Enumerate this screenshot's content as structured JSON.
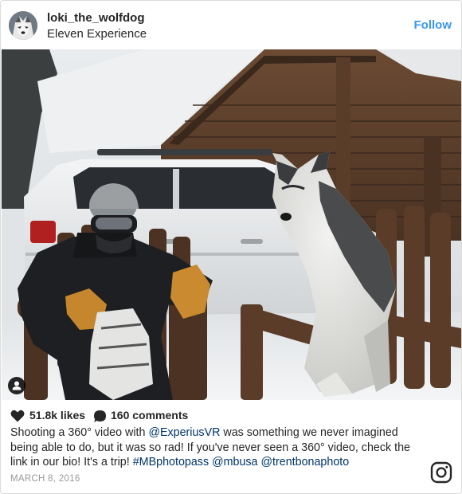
{
  "post": {
    "username": "loki_the_wolfdog",
    "location": "Eleven Experience",
    "follow_label": "Follow",
    "likes": "51.8k likes",
    "comments": "160 comments",
    "caption_parts": [
      {
        "text": "Shooting a 360° video with ",
        "mention": false
      },
      {
        "text": "@ExperiusVR",
        "mention": true
      },
      {
        "text": " was something we never imagined being able to do, but it was so rad! If you've never seen a 360° video, check the link in our bio! It's a trip! ",
        "mention": false
      },
      {
        "text": "#MBphotopass",
        "mention": true
      },
      {
        "text": " ",
        "mention": false
      },
      {
        "text": "@mbusa",
        "mention": true
      },
      {
        "text": " ",
        "mention": false
      },
      {
        "text": "@trentbonaphoto",
        "mention": true
      }
    ],
    "date": "MARCH 8, 2016"
  },
  "icons": {
    "avatar": "wolfdog-avatar",
    "user_tag": "person-tag-icon",
    "heart": "heart-icon",
    "comment": "comment-bubble-icon",
    "instagram": "instagram-logo-icon"
  },
  "colors": {
    "follow": "#3897f0",
    "mention": "#003569",
    "date": "#999999",
    "text": "#262626",
    "border": "#dbdbdb"
  }
}
